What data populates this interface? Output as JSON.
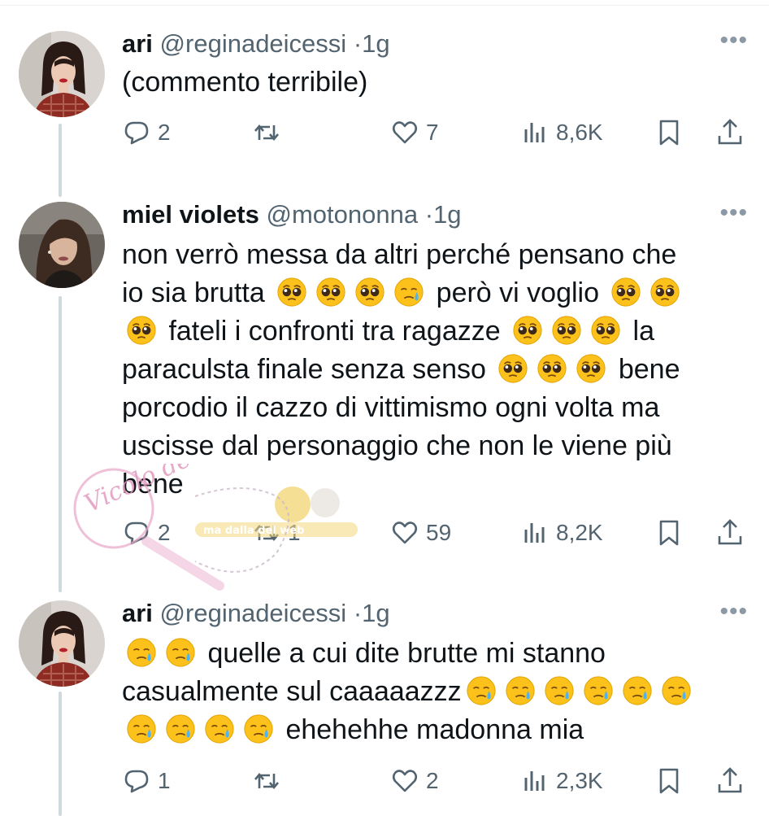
{
  "tweets": [
    {
      "author": "ari",
      "handle": "@reginadeicessi",
      "dot": "·",
      "time": "1g",
      "lines": [
        [
          {
            "t": "(commento terribile)"
          }
        ]
      ],
      "replies": "2",
      "retweets": "",
      "likes": "7",
      "views": "8,6K",
      "more": "•••"
    },
    {
      "author": "miel violets",
      "handle": "@motononna",
      "dot": "·",
      "time": "1g",
      "lines": [
        [
          {
            "t": "non verrò messa da altri perché pensano che"
          }
        ],
        [
          {
            "t": "io sia brutta "
          },
          {
            "e": "pleading"
          },
          {
            "e": "pleading"
          },
          {
            "e": "pleading"
          },
          {
            "e": "cry"
          },
          {
            "t": " però vi voglio "
          },
          {
            "e": "pleading"
          },
          {
            "e": "pleading"
          }
        ],
        [
          {
            "e": "pleading"
          },
          {
            "t": " fateli i confronti tra ragazze "
          },
          {
            "e": "pleading"
          },
          {
            "e": "pleading"
          },
          {
            "e": "pleading"
          },
          {
            "t": " la"
          }
        ],
        [
          {
            "t": "paraculsta finale senza senso "
          },
          {
            "e": "pleading"
          },
          {
            "e": "pleading"
          },
          {
            "e": "pleading"
          },
          {
            "t": " bene"
          }
        ],
        [
          {
            "t": "porcodio il cazzo di vittimismo ogni volta ma"
          }
        ],
        [
          {
            "t": "uscisse dal personaggio che non le viene più"
          }
        ],
        [
          {
            "t": "bene"
          }
        ]
      ],
      "replies": "2",
      "retweets": "1",
      "likes": "59",
      "views": "8,2K",
      "more": "•••"
    },
    {
      "author": "ari",
      "handle": "@reginadeicessi",
      "dot": "·",
      "time": "1g",
      "lines": [
        [
          {
            "e": "cry"
          },
          {
            "e": "cry"
          },
          {
            "t": " quelle a cui dite brutte mi stanno"
          }
        ],
        [
          {
            "t": "casualmente sul caaaaazzz"
          },
          {
            "e": "cry"
          },
          {
            "e": "cry"
          },
          {
            "e": "cry"
          },
          {
            "e": "cry"
          },
          {
            "e": "cry"
          },
          {
            "e": "cry"
          }
        ],
        [
          {
            "e": "cry"
          },
          {
            "e": "cry"
          },
          {
            "e": "cry"
          },
          {
            "e": "cry"
          },
          {
            "t": " ehehehhe madonna mia"
          }
        ]
      ],
      "replies": "1",
      "retweets": "",
      "likes": "2",
      "views": "2,3K",
      "more": "•••"
    }
  ],
  "watermark": {
    "logo_text": "Vicolo delle News",
    "badge_text": "ma dalla del web"
  },
  "icons": {
    "reply": "reply-icon",
    "retweet": "retweet-icon",
    "like": "like-icon",
    "views": "views-icon",
    "bookmark": "bookmark-icon",
    "share": "share-icon",
    "more": "more-icon"
  },
  "colors": {
    "text": "#0f1419",
    "secondary": "#536471",
    "thread_line": "#cfd9de",
    "watermark_pink": "#e8a6c8"
  }
}
